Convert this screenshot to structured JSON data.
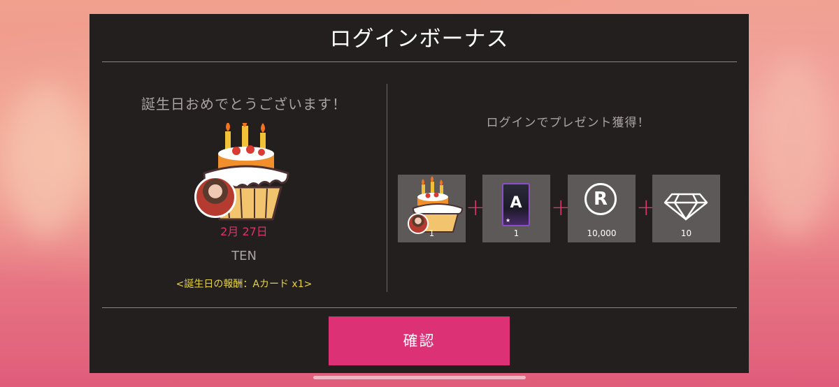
{
  "dialog": {
    "title": "ログインボーナス"
  },
  "birthday": {
    "heading": "誕生日おめでとうございます！",
    "date": "2月 27日",
    "name": "TEN",
    "reward_note": "<誕生日の報酬：Aカード x1>"
  },
  "login": {
    "heading": "ログインでプレゼント獲得！",
    "items": [
      {
        "icon": "birthday-cake-icon",
        "quantity": "1"
      },
      {
        "icon": "a-card-icon",
        "card_letter": "A",
        "quantity": "1"
      },
      {
        "icon": "r-coin-icon",
        "coin_letter": "R",
        "quantity": "10,000"
      },
      {
        "icon": "diamond-icon",
        "quantity": "10"
      }
    ],
    "separator": "+"
  },
  "buttons": {
    "confirm_label": "確認"
  },
  "colors": {
    "accent_pink": "#dd3175",
    "reward_yellow": "#e6d33a",
    "panel_bg": "#231f1f",
    "item_bg": "#5d5959"
  }
}
